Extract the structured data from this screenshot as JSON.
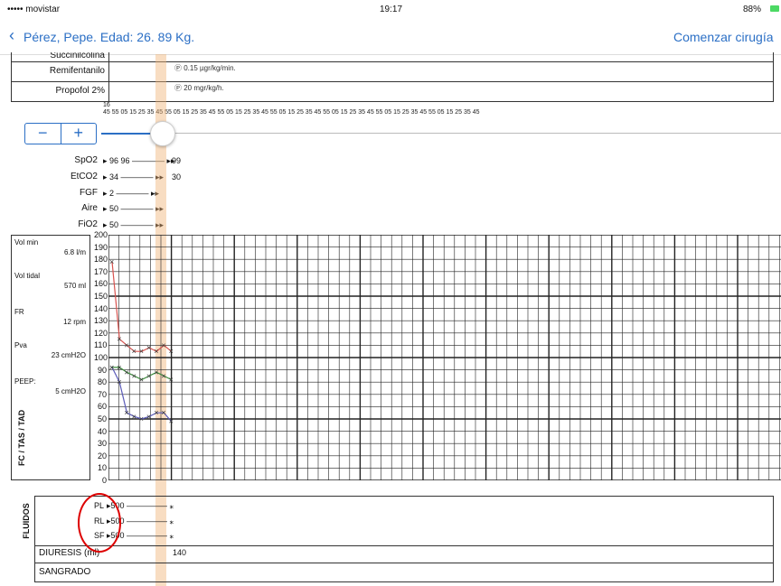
{
  "status_bar": {
    "carrier": "••••• movistar",
    "time": "19:17",
    "battery": "88%"
  },
  "nav": {
    "back_label": "Pérez, Pepe. Edad: 26. 89 Kg.",
    "action_label": "Comenzar cirugía"
  },
  "drugs": [
    {
      "name": "Succinilcolina",
      "dose": ""
    },
    {
      "name": "Remifentanilo",
      "dose": "Ⓟ 0.15 µgr/kg/min."
    },
    {
      "name": "Propofol 2%",
      "dose": "Ⓟ 20 mgr/kg/h."
    }
  ],
  "timeline": {
    "hour": "16",
    "ticks": "45  55  05  15  25  35  45  55  05  15  25  35  45  55  05  15  25  35  45  55  05  15  25  35  45  55  05  15  25  35  45  55  05  15  25  35  45  55  05  15  25  35  45"
  },
  "stepper": {
    "minus": "−",
    "plus": "+"
  },
  "params": [
    {
      "label": "SpO2",
      "values": "96  96",
      "end": "99"
    },
    {
      "label": "EtCO2",
      "values": "34",
      "end": "30"
    },
    {
      "label": "FGF",
      "values": "2",
      "end": ""
    },
    {
      "label": "Aire",
      "values": "50",
      "end": ""
    },
    {
      "label": "FiO2",
      "values": "50",
      "end": ""
    }
  ],
  "vent": [
    {
      "label": "Vol min",
      "value": "6.8 l/m"
    },
    {
      "label": "Vol tidal",
      "value": "570 ml"
    },
    {
      "label": "FR",
      "value": "12 rpm"
    },
    {
      "label": "Pva",
      "value": "23 cmH2O"
    },
    {
      "label": "PEEP:",
      "value": "5 cmH2O"
    }
  ],
  "y_axis": {
    "label": "FC / TAS / TAD",
    "ticks": [
      "200",
      "190",
      "180",
      "170",
      "160",
      "150",
      "140",
      "130",
      "120",
      "110",
      "100",
      "90",
      "80",
      "70",
      "60",
      "50",
      "40",
      "30",
      "20",
      "10",
      "0"
    ]
  },
  "chart_data": {
    "type": "line",
    "ylim": [
      0,
      200
    ],
    "series": [
      {
        "color": "#d9534f",
        "values": [
          178,
          115,
          110,
          105,
          105,
          108,
          105,
          110,
          105
        ]
      },
      {
        "color": "#3a8a3a",
        "values": [
          92,
          92,
          88,
          85,
          82,
          85,
          88,
          85,
          82
        ]
      },
      {
        "color": "#5b5bb8",
        "values": [
          92,
          80,
          55,
          52,
          50,
          52,
          55,
          55,
          48
        ]
      }
    ]
  },
  "fluids": {
    "title": "FLUIDOS",
    "items": [
      {
        "label": "PL",
        "value": "500"
      },
      {
        "label": "RL",
        "value": "500"
      },
      {
        "label": "SF",
        "value": "500"
      }
    ],
    "diuresis_label": "DIURESIS (ml)",
    "diuresis_value": "140",
    "sangrado_label": "SANGRADO"
  }
}
